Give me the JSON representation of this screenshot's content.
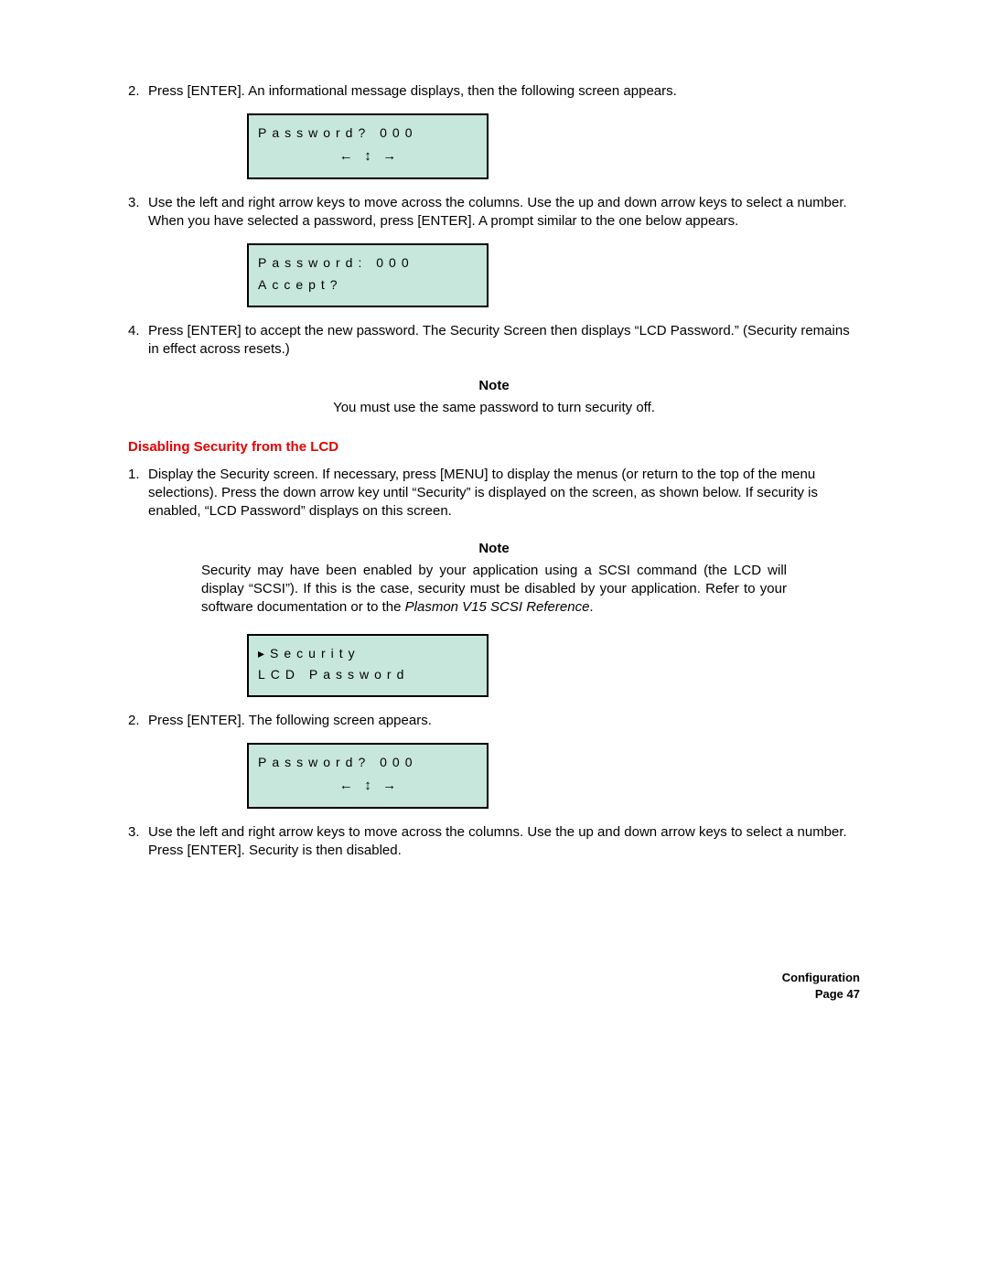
{
  "steps_a": {
    "num2": "2.",
    "text2": "Press [ENTER]. An informational message displays, then the following screen appears.",
    "num3": "3.",
    "text3": "Use the left and right arrow keys to move across the columns. Use the up and down arrow keys to select a number. When you have selected a password, press [ENTER]. A prompt similar to the one below appears.",
    "num4": "4.",
    "text4": "Press [ENTER] to accept the new password. The Security Screen then displays “LCD Password.” (Security remains in effect across resets.)"
  },
  "lcd1": {
    "line1": "Password? 000",
    "arrows": "←   ↕   →"
  },
  "lcd2": {
    "line1": "Password: 000",
    "line2": "Accept?"
  },
  "note1": {
    "head": "Note",
    "body": "You must use the same password to turn security off."
  },
  "section_head": "Disabling Security from the LCD",
  "steps_b": {
    "num1": "1.",
    "text1": "Display the Security screen. If necessary, press [MENU] to display the menus (or return to the top of the menu selections). Press the down arrow key until “Security” is displayed on the screen, as shown below. If security is enabled, “LCD Password” displays on this screen.",
    "num2": "2.",
    "text2": "Press [ENTER]. The following screen appears.",
    "num3": "3.",
    "text3": "Use the left and right arrow keys to move across the columns. Use the up and down arrow keys to select a number. Press [ENTER]. Security is then disabled."
  },
  "note2": {
    "head": "Note",
    "body_pre": "Security may have been enabled by your application using a SCSI command (the LCD will display “SCSI”). If this is the case, security must be disabled by your application. Refer to your software documentation or to the ",
    "body_italic": "Plasmon V15 SCSI Reference",
    "body_post": "."
  },
  "lcd3": {
    "line1": "▸Security",
    "line2": " LCD Password"
  },
  "lcd4": {
    "line1": "Password? 000",
    "arrows": "←   ↕   →"
  },
  "footer": {
    "line1": "Configuration",
    "line2": "Page 47"
  }
}
